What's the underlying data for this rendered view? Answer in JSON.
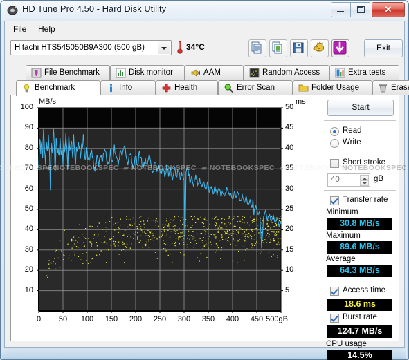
{
  "window": {
    "title": "HD Tune Pro 4.50 - Hard Disk Utility",
    "icon": "hdtune-logo-icon",
    "minimize_label": "",
    "maximize_label": "",
    "close_label": "✕"
  },
  "menu": {
    "items": [
      {
        "label": "File"
      },
      {
        "label": "Help"
      }
    ]
  },
  "toolbar": {
    "drive": "Hitachi HTS545050B9A300 (500 gB)",
    "temperature": "34°C",
    "buttons": [
      {
        "name": "copy-text-button",
        "icon": "copy-document-icon"
      },
      {
        "name": "copy-image-button",
        "icon": "copy-image-icon"
      },
      {
        "name": "save-button",
        "icon": "floppy-disk-icon"
      },
      {
        "name": "folder-button",
        "icon": "gold-hand-icon"
      },
      {
        "name": "download-button",
        "icon": "download-arrow-icon"
      }
    ],
    "exit_label": "Exit"
  },
  "tabs": {
    "top_row": [
      {
        "label": "File Benchmark",
        "icon": "file-benchmark-icon",
        "active": false
      },
      {
        "label": "Disk monitor",
        "icon": "disk-monitor-icon",
        "active": false
      },
      {
        "label": "AAM",
        "icon": "speaker-icon",
        "active": false
      },
      {
        "label": "Random Access",
        "icon": "random-access-icon",
        "active": false
      },
      {
        "label": "Extra tests",
        "icon": "extra-tests-icon",
        "active": false
      }
    ],
    "bottom_row": [
      {
        "label": "Benchmark",
        "icon": "bulb-icon",
        "active": true
      },
      {
        "label": "Info",
        "icon": "info-icon",
        "active": false
      },
      {
        "label": "Health",
        "icon": "red-cross-icon",
        "active": false
      },
      {
        "label": "Error Scan",
        "icon": "magnifier-icon",
        "active": false
      },
      {
        "label": "Folder Usage",
        "icon": "folder-icon",
        "active": false
      },
      {
        "label": "Erase",
        "icon": "trash-icon",
        "active": false
      }
    ]
  },
  "panel": {
    "start_label": "Start",
    "read_label": "Read",
    "write_label": "Write",
    "read_selected": true,
    "short_stroke_label": "Short stroke",
    "short_stroke_checked": false,
    "short_stroke_value": "40",
    "short_stroke_unit": "gB",
    "transfer_rate_label": "Transfer rate",
    "transfer_rate_checked": true,
    "minimum_label": "Minimum",
    "minimum_value": "30.8 MB/s",
    "maximum_label": "Maximum",
    "maximum_value": "89.6 MB/s",
    "average_label": "Average",
    "average_value": "64.3 MB/s",
    "access_time_label": "Access time",
    "access_time_checked": true,
    "access_time_value": "18.6 ms",
    "burst_rate_label": "Burst rate",
    "burst_rate_checked": true,
    "burst_rate_value": "124.7 MB/s",
    "cpu_usage_label": "CPU usage",
    "cpu_usage_value": "14.5%"
  },
  "watermark": {
    "text": "NOTEBOOKSPEC"
  },
  "chart_data": {
    "type": "line",
    "title": "",
    "ylabel": "MB/s",
    "y2label": "ms",
    "xlabel": "",
    "x_unit": "gB",
    "xlim": [
      0,
      500
    ],
    "ylim": [
      0,
      100
    ],
    "y2lim": [
      0,
      50
    ],
    "grid": true,
    "background_color": "#1d1d1d",
    "upper_band_color": "#050505",
    "grid_color": "#9a9a9a",
    "xticks": [
      0,
      50,
      100,
      150,
      200,
      250,
      300,
      350,
      400,
      450,
      500
    ],
    "xticklabels": [
      "0",
      "50",
      "100",
      "150",
      "200",
      "250",
      "300",
      "350",
      "400",
      "450",
      "500gB"
    ],
    "yticks": [
      0,
      10,
      20,
      30,
      40,
      50,
      60,
      70,
      80,
      90,
      100
    ],
    "y2ticks": [
      0,
      5,
      10,
      15,
      20,
      25,
      30,
      35,
      40,
      45,
      50
    ],
    "series": [
      {
        "name": "Transfer rate",
        "color": "#3fb4e8",
        "type": "line",
        "axis": "left",
        "x": [
          0,
          2,
          4,
          6,
          8,
          10,
          12,
          14,
          16,
          18,
          20,
          22,
          24,
          26,
          28,
          30,
          32,
          34,
          36,
          38,
          40,
          42,
          44,
          46,
          48,
          50,
          52,
          54,
          56,
          58,
          60,
          62,
          64,
          66,
          68,
          70,
          72,
          74,
          76,
          78,
          80,
          82,
          84,
          86,
          88,
          90,
          92,
          94,
          96,
          98,
          100,
          104,
          108,
          112,
          116,
          120,
          124,
          128,
          132,
          136,
          140,
          144,
          148,
          152,
          156,
          160,
          164,
          168,
          172,
          176,
          180,
          184,
          188,
          192,
          196,
          200,
          204,
          208,
          212,
          216,
          220,
          224,
          228,
          232,
          236,
          240,
          244,
          248,
          252,
          256,
          260,
          264,
          268,
          272,
          276,
          280,
          284,
          288,
          292,
          296,
          300,
          302,
          304,
          308,
          312,
          316,
          320,
          324,
          328,
          332,
          336,
          340,
          344,
          348,
          352,
          356,
          360,
          364,
          368,
          372,
          376,
          380,
          384,
          388,
          392,
          396,
          400,
          404,
          408,
          412,
          416,
          420,
          424,
          428,
          432,
          436,
          440,
          442,
          444,
          448,
          452,
          456,
          460,
          464,
          468,
          472,
          476,
          480,
          484,
          488,
          492,
          496,
          500
        ],
        "y": [
          72,
          86,
          78,
          83,
          76,
          88,
          80,
          74,
          83,
          78,
          85,
          79,
          61,
          83,
          76,
          89.6,
          82,
          70,
          84,
          78,
          81,
          75,
          83,
          77,
          80,
          74,
          82,
          78,
          85,
          79,
          72,
          84,
          77,
          81,
          83,
          76,
          85,
          79,
          73,
          82,
          78,
          84,
          80,
          76,
          83,
          79,
          86,
          81,
          74,
          80,
          77,
          72,
          79,
          74,
          70,
          76,
          71,
          78,
          73,
          80,
          75,
          71,
          78,
          74,
          80,
          76,
          72,
          79,
          75,
          81,
          77,
          73,
          78,
          74,
          70,
          76,
          72,
          78,
          74,
          70,
          75,
          71,
          76,
          72,
          68,
          74,
          70,
          72,
          68,
          70,
          66,
          71,
          67,
          69,
          65,
          71,
          67,
          69,
          66,
          68,
          64,
          34,
          68,
          70,
          64,
          66,
          62,
          67,
          63,
          65,
          61,
          64,
          60,
          63,
          59,
          62,
          58,
          61,
          57,
          60,
          57,
          59,
          56,
          60,
          57,
          58,
          55,
          59,
          56,
          58,
          54,
          57,
          53,
          56,
          52,
          55,
          50,
          54,
          48,
          52,
          47,
          49,
          31,
          46,
          50,
          45,
          48,
          44,
          47,
          43,
          46,
          41,
          44,
          42,
          45,
          40,
          43
        ],
        "min": 30.8,
        "max": 89.6,
        "avg": 64.3
      },
      {
        "name": "Access time",
        "color": "#e8e83c",
        "type": "scatter",
        "axis": "right",
        "average_ms": 18.6,
        "point_count": 640,
        "range_ms": [
          5,
          22
        ],
        "description": "Yellow scatter cloud rising from ~6 ms near 0 gB to ~20 ms beyond 150 gB"
      }
    ]
  }
}
